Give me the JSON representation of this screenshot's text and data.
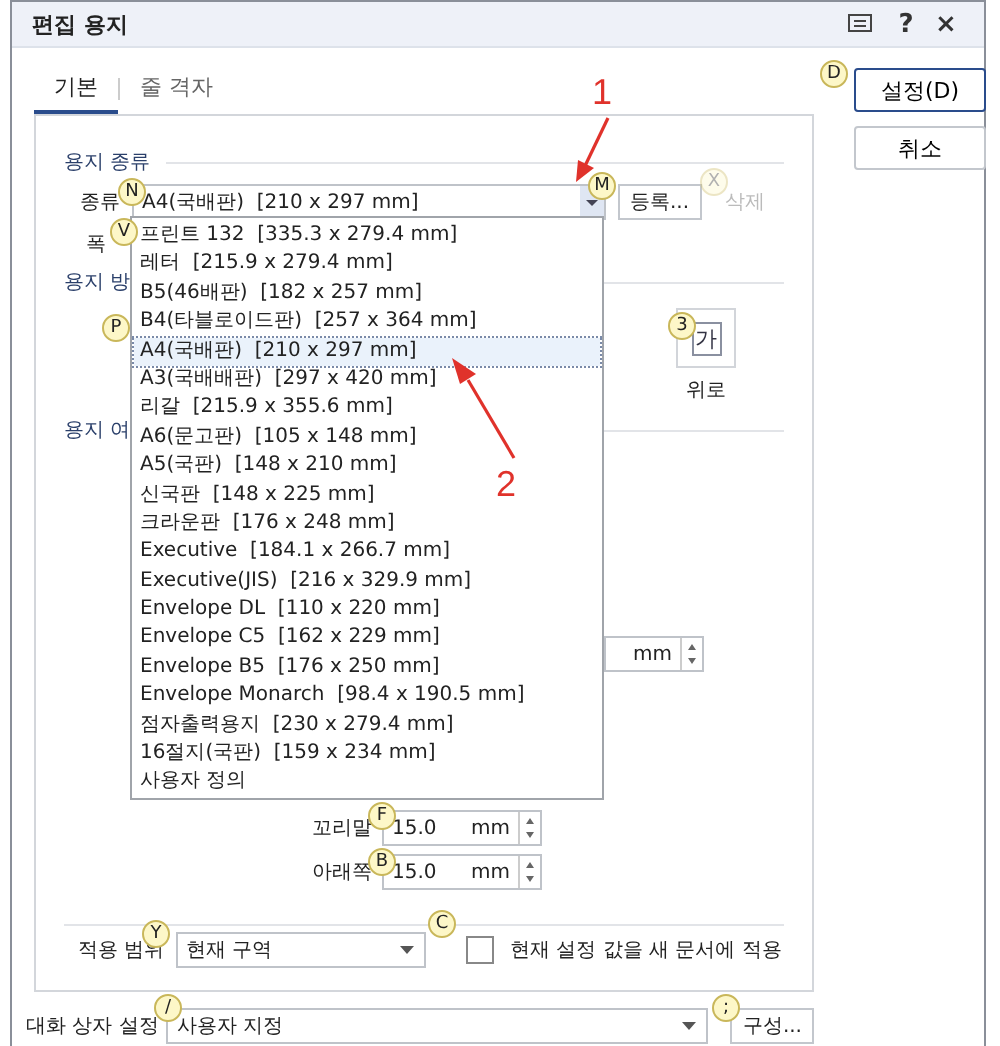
{
  "window": {
    "title": "편집 용지",
    "help": "?",
    "close": "×"
  },
  "tabs": [
    {
      "label": "기본",
      "selected": true
    },
    {
      "label": "줄 격자",
      "selected": false
    }
  ],
  "buttons": [
    {
      "label": "설정(D)",
      "default": true
    },
    {
      "label": "취소",
      "default": false
    }
  ],
  "paper_type": {
    "heading": "용지 종류",
    "kind_label": "종류",
    "kind_value": "A4(국배판)  [210 x 297 mm]",
    "register_button": "등록...",
    "delete_button": {
      "label": "삭제",
      "disabled": true
    },
    "width_label": "폭"
  },
  "dropdown": {
    "items": [
      {
        "label": "프린트 132  [335.3 x 279.4 mm]",
        "selected": false
      },
      {
        "label": "레터  [215.9 x 279.4 mm]",
        "selected": false
      },
      {
        "label": "B5(46배판)  [182 x 257 mm]",
        "selected": false
      },
      {
        "label": "B4(타블로이드판)  [257 x 364 mm]",
        "selected": false
      },
      {
        "label": "A4(국배판)  [210 x 297 mm]",
        "selected": true
      },
      {
        "label": "A3(국배배판)  [297 x 420 mm]",
        "selected": false
      },
      {
        "label": "리갈  [215.9 x 355.6 mm]",
        "selected": false
      },
      {
        "label": "A6(문고판)  [105 x 148 mm]",
        "selected": false
      },
      {
        "label": "A5(국판)  [148 x 210 mm]",
        "selected": false
      },
      {
        "label": "신국판  [148 x 225 mm]",
        "selected": false
      },
      {
        "label": "크라운판  [176 x 248 mm]",
        "selected": false
      },
      {
        "label": "Executive  [184.1 x 266.7 mm]",
        "selected": false
      },
      {
        "label": "Executive(JIS)  [216 x 329.9 mm]",
        "selected": false
      },
      {
        "label": "Envelope DL  [110 x 220 mm]",
        "selected": false
      },
      {
        "label": "Envelope C5  [162 x 229 mm]",
        "selected": false
      },
      {
        "label": "Envelope B5  [176 x 250 mm]",
        "selected": false
      },
      {
        "label": "Envelope Monarch  [98.4 x 190.5 mm]",
        "selected": false
      },
      {
        "label": "점자출력용지  [230 x 279.4 mm]",
        "selected": false
      },
      {
        "label": "16절지(국판)  [159 x 234 mm]",
        "selected": false
      },
      {
        "label": "사용자 정의",
        "selected": false
      }
    ]
  },
  "orientation": {
    "heading": "용지 방",
    "option": {
      "glyph": "가",
      "label": "위로"
    }
  },
  "margins": {
    "heading": "용지 여",
    "partial_unit": "mm",
    "fields": [
      {
        "label": "꼬리말",
        "value": "15.0",
        "unit": "mm"
      },
      {
        "label": "아래쪽",
        "value": "15.0",
        "unit": "mm"
      }
    ]
  },
  "apply": {
    "label": "적용 범위",
    "value": "현재 구역",
    "checkbox_label": "현재 설정 값을 새 문서에 적용",
    "checked": false
  },
  "dialog_settings": {
    "label": "대화 상자 설정",
    "value": "사용자 지정",
    "button": "구성..."
  },
  "key_tips": [
    {
      "key": "N",
      "disabled": false
    },
    {
      "key": "V",
      "disabled": false
    },
    {
      "key": "M",
      "disabled": false
    },
    {
      "key": "X",
      "disabled": true
    },
    {
      "key": "P",
      "disabled": false
    },
    {
      "key": "3",
      "disabled": false
    },
    {
      "key": "D",
      "disabled": false
    },
    {
      "key": "F",
      "disabled": false
    },
    {
      "key": "B",
      "disabled": false
    },
    {
      "key": "Y",
      "disabled": false
    },
    {
      "key": "C",
      "disabled": false
    },
    {
      "key": "/",
      "disabled": false
    },
    {
      "key": ";",
      "disabled": false
    }
  ],
  "annotations": [
    "1",
    "2"
  ]
}
